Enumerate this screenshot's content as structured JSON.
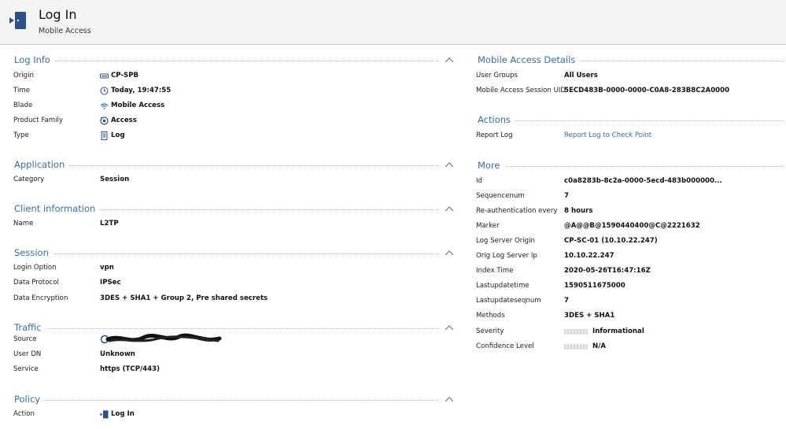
{
  "header": {
    "title": "Log In",
    "subtitle": "Mobile Access"
  },
  "left": {
    "log_info": {
      "title": "Log Info",
      "rows": [
        {
          "label": "Origin",
          "value": "CP-SPB",
          "icon": "gateway-icon"
        },
        {
          "label": "Time",
          "value": "Today, 19:47:55",
          "icon": "clock-icon"
        },
        {
          "label": "Blade",
          "value": "Mobile Access",
          "icon": "wifi-icon"
        },
        {
          "label": "Product Family",
          "value": "Access",
          "icon": "access-icon"
        },
        {
          "label": "Type",
          "value": "Log",
          "icon": "log-icon"
        }
      ]
    },
    "application": {
      "title": "Application",
      "rows": [
        {
          "label": "Category",
          "value": "Session"
        }
      ]
    },
    "client": {
      "title": "Client information",
      "rows": [
        {
          "label": "Name",
          "value": "L2TP"
        }
      ]
    },
    "session": {
      "title": "Session",
      "rows": [
        {
          "label": "Login Option",
          "value": "vpn"
        },
        {
          "label": "Data Protocol",
          "value": "IPSec"
        },
        {
          "label": "Data Encryption",
          "value": "3DES + SHA1 + Group 2, Pre shared secrets"
        }
      ]
    },
    "traffic": {
      "title": "Traffic",
      "rows": [
        {
          "label": "Source",
          "value": ""
        },
        {
          "label": "User DN",
          "value": "Unknown"
        },
        {
          "label": "Service",
          "value": "https (TCP/443)"
        }
      ]
    },
    "policy": {
      "title": "Policy",
      "rows": [
        {
          "label": "Action",
          "value": "Log In",
          "icon": "login-icon"
        }
      ]
    }
  },
  "right": {
    "mobile": {
      "title": "Mobile Access Details",
      "rows": [
        {
          "label": "User Groups",
          "value": "All Users"
        },
        {
          "label": "Mobile Access Session UID",
          "value": "5ECD483B-0000-0000-C0A8-283B8C2A0000"
        }
      ]
    },
    "actions": {
      "title": "Actions",
      "rows": [
        {
          "label": "Report Log",
          "value": "Report Log to Check Point"
        }
      ]
    },
    "more": {
      "title": "More",
      "rows": [
        {
          "label": "Id",
          "value": "c0a8283b-8c2a-0000-5ecd-483b000000..."
        },
        {
          "label": "Sequencenum",
          "value": "7"
        },
        {
          "label": "Re-authentication every",
          "value": "8 hours"
        },
        {
          "label": "Marker",
          "value": "@A@@B@1590440400@C@2221632"
        },
        {
          "label": "Log Server Origin",
          "value": "CP-SC-01 (10.10.22.247)"
        },
        {
          "label": "Orig Log Server Ip",
          "value": "10.10.22.247"
        },
        {
          "label": "Index Time",
          "value": "2020-05-26T16:47:16Z"
        },
        {
          "label": "Lastupdatetime",
          "value": "1590511675000"
        },
        {
          "label": "Lastupdateseqnum",
          "value": "7"
        },
        {
          "label": "Methods",
          "value": "3DES + SHA1"
        },
        {
          "label": "Severity",
          "value": "Informational"
        },
        {
          "label": "Confidence Level",
          "value": "N/A"
        }
      ]
    }
  },
  "colors": {
    "accent": "#3a6ea5",
    "header_bg": "#f4f4f4"
  }
}
